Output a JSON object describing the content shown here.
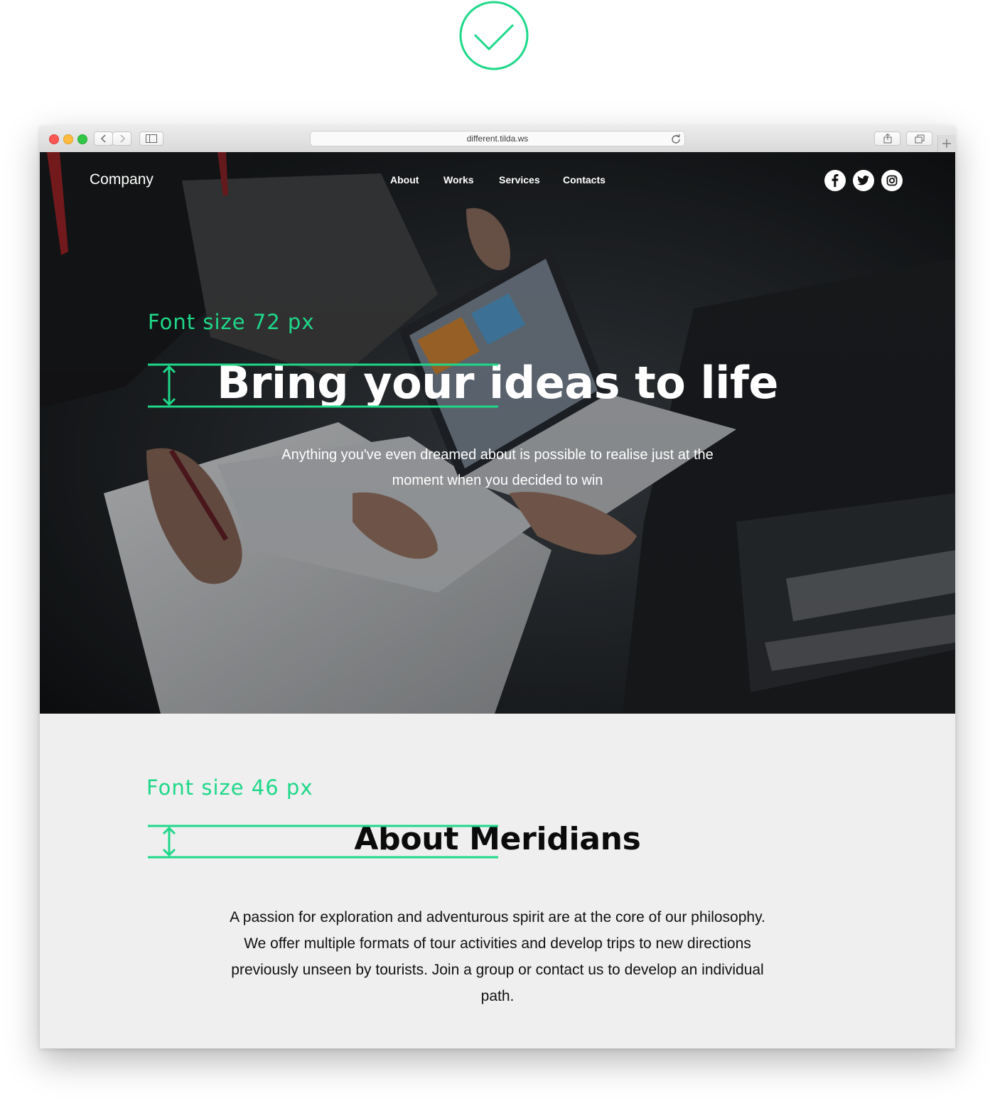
{
  "browser": {
    "url": "different.tilda.ws"
  },
  "site": {
    "logo": "Company",
    "nav": [
      "About",
      "Works",
      "Services",
      "Contacts"
    ],
    "social": [
      "facebook-icon",
      "twitter-icon",
      "instagram-icon"
    ]
  },
  "hero": {
    "annotation": "Font size 72 px",
    "title": "Bring your ideas to life",
    "subtitle": "Anything you've even dreamed about is possible to realise just at the moment when you decided to win"
  },
  "about": {
    "annotation": "Font size 46 px",
    "title": "About Meridians",
    "text": "A passion for exploration and adventurous spirit are at the core of our philosophy. We offer multiple formats of tour activities and develop trips to new directions previously unseen by tourists. Join a group or contact us to develop an individual path."
  },
  "colors": {
    "accent": "#1ed889",
    "hero_text": "#ffffff",
    "section_bg": "#efefef"
  }
}
